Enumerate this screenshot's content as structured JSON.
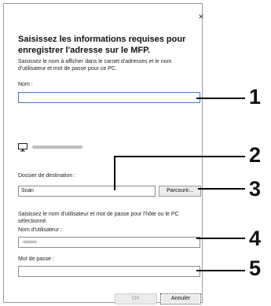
{
  "dialog": {
    "close_glyph": "×",
    "heading": "Saisissez les informations requises pour enregistrer l'adresse sur le MFP.",
    "intro": "Saisissez le nom à afficher dans le carnet d'adresses et le nom d'utilisateur et mot de passe pour ce PC.",
    "name_label": "Nom :",
    "name_value": "",
    "computer_icon": "monitor-icon",
    "destination_label": "Dossier de destination :",
    "destination_value": "Scan",
    "browse_button": "Parcourir...",
    "credentials_intro": "Saisissez le nom d'utilisateur et mot de passe pour l'hôte ou le PC sélectionné.",
    "username_label": "Nom d'utilisateur :",
    "password_label": "Mot de passe :",
    "password_value": "",
    "ok_button": "OK",
    "cancel_button": "Annuler"
  },
  "callouts": [
    "1",
    "2",
    "3",
    "4",
    "5"
  ]
}
